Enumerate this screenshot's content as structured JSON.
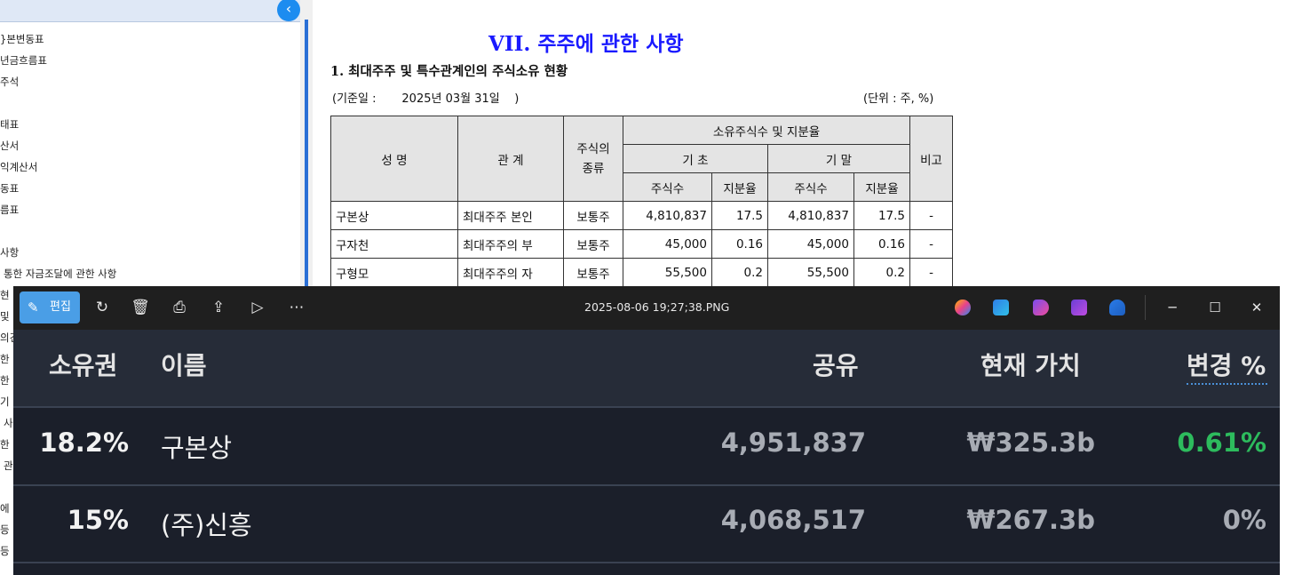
{
  "left_panel": {
    "toc_items": [
      "}본변동표",
      "년금흐름표",
      "주석",
      "",
      "태표",
      "산서",
      "익계산서",
      "동표",
      "름표",
      "",
      "사항",
      "통한 자금조달에 관한 사항",
      "현",
      "및",
      "의견",
      "한",
      "한",
      "기",
      "사",
      "한",
      "관",
      "",
      "에",
      "등",
      "등"
    ]
  },
  "document": {
    "title": "VII. 주주에 관한 사항",
    "subtitle": "1. 최대주주 및 특수관계인의 주식소유 현황",
    "basis_label": "(기준일 :",
    "basis_date": "2025년 03월 31일",
    "basis_close": ")",
    "unit": "(단위 : 주, %)",
    "table": {
      "headers": {
        "name": "성 명",
        "relation": "관 계",
        "stock_type": "주식의\n종류",
        "ownership": "소유주식수 및 지분율",
        "start": "기 초",
        "end": "기 말",
        "shares": "주식수",
        "ratio": "지분율",
        "note": "비고"
      },
      "rows": [
        {
          "name": "구본상",
          "relation": "최대주주 본인",
          "type": "보통주",
          "start_shares": "4,810,837",
          "start_ratio": "17.5",
          "end_shares": "4,810,837",
          "end_ratio": "17.5",
          "note": "-"
        },
        {
          "name": "구자천",
          "relation": "최대주주의 부",
          "type": "보통주",
          "start_shares": "45,000",
          "start_ratio": "0.16",
          "end_shares": "45,000",
          "end_ratio": "0.16",
          "note": "-"
        },
        {
          "name": "구형모",
          "relation": "최대주주의 자",
          "type": "보통주",
          "start_shares": "55,500",
          "start_ratio": "0.2",
          "end_shares": "55,500",
          "end_ratio": "0.2",
          "note": "-"
        }
      ]
    }
  },
  "photo_viewer": {
    "edit_label": "편집",
    "file_name": "2025-08-06 19;27;38.PNG",
    "toolbar_icons": [
      "rotate-icon",
      "delete-icon",
      "print-icon",
      "share-icon",
      "slideshow-icon",
      "more-icon"
    ],
    "app_icons": [
      "copilot-icon",
      "designer-icon",
      "clipchamp-icon",
      "photos-icon",
      "onedrive-icon"
    ],
    "columns": {
      "ownership": "소유권",
      "name": "이름",
      "shares": "공유",
      "value": "현재 가치",
      "change": "변경 %"
    },
    "rows": [
      {
        "ownership": "18.2%",
        "name": "구본상",
        "shares": "4,951,837",
        "value": "₩325.3b",
        "change": "0.61%",
        "change_color": "#2dbb5d"
      },
      {
        "ownership": "15%",
        "name": "(주)신흥",
        "shares": "4,068,517",
        "value": "₩267.3b",
        "change": "0%",
        "change_color": "#a8acb4"
      }
    ]
  }
}
